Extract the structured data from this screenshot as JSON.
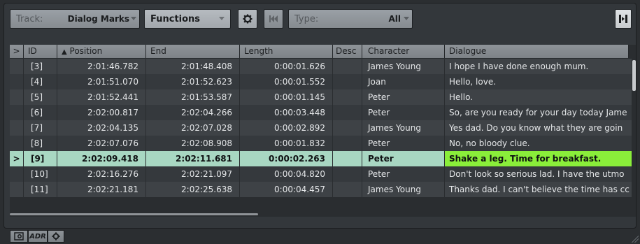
{
  "toolbar": {
    "track_label": "Track:",
    "track_value": "Dialog Marks",
    "functions_label": "Functions",
    "gear_icon": "gear-icon",
    "prev_icon": "skip-back-icon",
    "type_label": "Type:",
    "type_value": "All",
    "right_icon": "panel-toggle-icon"
  },
  "table": {
    "columns": [
      ">",
      "ID",
      "Position",
      "End",
      "Length",
      "Desc",
      "Character",
      "Dialogue"
    ],
    "sort_column": "Position",
    "rows": [
      {
        "marker": "",
        "id": "[3]",
        "position": "2:01:46.782",
        "end": "2:01:48.408",
        "length": "0:00:01.626",
        "desc": "",
        "character": "James Young",
        "dialogue": "I hope I have done enough mum."
      },
      {
        "marker": "",
        "id": "[4]",
        "position": "2:01:51.070",
        "end": "2:01:52.623",
        "length": "0:00:01.552",
        "desc": "",
        "character": "Joan",
        "dialogue": "Hello, love."
      },
      {
        "marker": "",
        "id": "[5]",
        "position": "2:01:52.441",
        "end": "2:01:53.587",
        "length": "0:00:01.145",
        "desc": "",
        "character": "Peter",
        "dialogue": "Hello."
      },
      {
        "marker": "",
        "id": "[6]",
        "position": "2:02:00.817",
        "end": "2:02:04.266",
        "length": "0:00:03.448",
        "desc": "",
        "character": "Peter",
        "dialogue": "So, are you ready for your day today Jame"
      },
      {
        "marker": "",
        "id": "[7]",
        "position": "2:02:04.135",
        "end": "2:02:07.028",
        "length": "0:00:02.892",
        "desc": "",
        "character": "James Young",
        "dialogue": "Yes dad. Do you know what they are goin"
      },
      {
        "marker": "",
        "id": "[8]",
        "position": "2:02:07.076",
        "end": "2:02:08.908",
        "length": "0:00:01.832",
        "desc": "",
        "character": "Peter",
        "dialogue": "No, no bloody clue."
      },
      {
        "marker": ">",
        "id": "[9]",
        "position": "2:02:09.418",
        "end": "2:02:11.681",
        "length": "0:00:02.263",
        "desc": "",
        "character": "Peter",
        "dialogue": "Shake a leg. Time for breakfast.",
        "selected": true
      },
      {
        "marker": "",
        "id": "[10]",
        "position": "2:02:16.276",
        "end": "2:02:21.097",
        "length": "0:00:04.820",
        "desc": "",
        "character": "Peter",
        "dialogue": "Don't look so serious lad. I have the utmo"
      },
      {
        "marker": "",
        "id": "[11]",
        "position": "2:02:21.181",
        "end": "2:02:25.638",
        "length": "0:00:04.457",
        "desc": "",
        "character": "James Young",
        "dialogue": "Thanks dad. I can't believe the time has cc"
      }
    ]
  },
  "bottom": {
    "btn1_icon": "settings-panel-icon",
    "btn2_label": "ADR",
    "btn3_icon": "gear-icon"
  },
  "colors": {
    "selected_row": "#a8d7c2",
    "selected_dialogue": "#8aee3a"
  }
}
